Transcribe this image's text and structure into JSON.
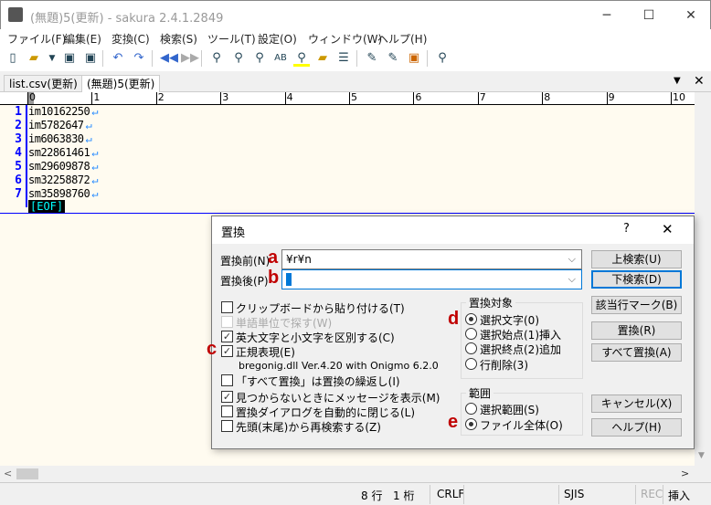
{
  "window": {
    "title": "(無題)5(更新) - sakura 2.4.1.2849",
    "minimize": "─",
    "maximize": "☐",
    "close": "✕"
  },
  "menu": [
    "ファイル(F)",
    "編集(E)",
    "変換(C)",
    "検索(S)",
    "ツール(T)",
    "設定(O)",
    "ウィンドウ(W)",
    "ヘルプ(H)"
  ],
  "toolbar": [
    "new-file-icon",
    "open-folder-icon",
    "dropdown-icon",
    "save-icon",
    "save-all-icon",
    "undo-icon",
    "redo-icon",
    "back-icon",
    "forward-icon",
    "find-icon",
    "find-next-icon",
    "find-prev-icon",
    "replace-icon",
    "highlight-icon",
    "grep-icon",
    "outline-icon",
    "compare-icon",
    "settings-icon",
    "window-icon",
    "preview-icon"
  ],
  "tabs": [
    {
      "label": "list.csv(更新)",
      "active": false
    },
    {
      "label": "(無題)5(更新)",
      "active": true
    }
  ],
  "tab_controls": {
    "dropdown": "▼",
    "close": "✕"
  },
  "ruler": [
    "0",
    "1",
    "2",
    "3",
    "4",
    "5",
    "6",
    "7",
    "8",
    "9",
    "10"
  ],
  "editor": {
    "lines": [
      "im10162250",
      "im5782647",
      "im6063830",
      "sm22861461",
      "sm29609878",
      "sm32258872",
      "sm35898760"
    ],
    "line_numbers": [
      "1",
      "2",
      "3",
      "4",
      "5",
      "6",
      "7"
    ],
    "newline_mark": "↵",
    "eof": "[EOF]"
  },
  "status": {
    "position_line": "8 行",
    "position_col": "1 桁",
    "newline": "CRLF",
    "encoding": "SJIS",
    "rec": "REC",
    "mode": "挿入"
  },
  "dialog": {
    "title": "置換",
    "help": "?",
    "close": "✕",
    "find_label": "置換前(N)",
    "find_value": "¥r¥n",
    "replace_label": "置換後(P)",
    "replace_value": "",
    "buttons": {
      "search_up": "上検索(U)",
      "search_down": "下検索(D)",
      "mark_lines": "該当行マーク(B)",
      "replace": "置換(R)",
      "replace_all": "すべて置換(A)",
      "cancel": "キャンセル(X)",
      "help": "ヘルプ(H)"
    },
    "options": [
      {
        "label": "クリップボードから貼り付ける(T)",
        "checked": false,
        "disabled": false
      },
      {
        "label": "単語単位で探す(W)",
        "checked": false,
        "disabled": true
      },
      {
        "label": "英大文字と小文字を区別する(C)",
        "checked": true,
        "disabled": false
      },
      {
        "label": "正規表現(E)",
        "checked": true,
        "disabled": false
      },
      {
        "label": "「すべて置換」は置換の繰返し(I)",
        "checked": false,
        "disabled": false
      },
      {
        "label": "見つからないときにメッセージを表示(M)",
        "checked": true,
        "disabled": false
      },
      {
        "label": "置換ダイアログを自動的に閉じる(L)",
        "checked": false,
        "disabled": false
      },
      {
        "label": "先頭(末尾)から再検索する(Z)",
        "checked": false,
        "disabled": false
      }
    ],
    "regex_lib": "bregonig.dll Ver.4.20 with Onigmo 6.2.0",
    "target_group": {
      "label": "置換対象",
      "options": [
        "選択文字(0)",
        "選択始点(1)挿入",
        "選択終点(2)追加",
        "行削除(3)"
      ],
      "selected": 0
    },
    "range_group": {
      "label": "範囲",
      "options": [
        "選択範囲(S)",
        "ファイル全体(O)"
      ],
      "selected": 1
    }
  },
  "annotations": {
    "a": "a",
    "b": "b",
    "c": "c",
    "d": "d",
    "e": "e",
    "color": "#c00000"
  }
}
